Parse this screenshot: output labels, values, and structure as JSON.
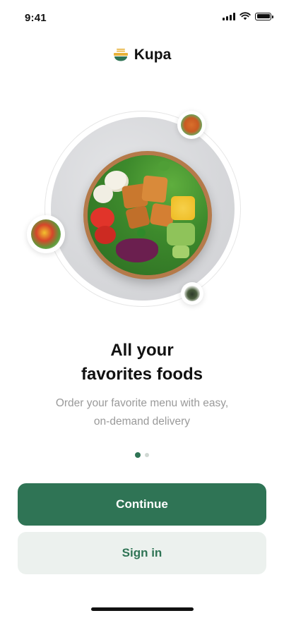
{
  "status_bar": {
    "time": "9:41"
  },
  "brand": {
    "name": "Kupa",
    "icon": "bowl-logo-icon"
  },
  "onboarding": {
    "headline_line1": "All your",
    "headline_line2": "favorites foods",
    "subtitle_line1": "Order your favorite menu with easy,",
    "subtitle_line2": "on-demand delivery",
    "page_index": 0,
    "page_count": 2
  },
  "actions": {
    "continue_label": "Continue",
    "signin_label": "Sign in"
  },
  "colors": {
    "accent": "#2f7455",
    "secondary_bg": "#ecf1ee",
    "muted_text": "#9a9a9a"
  }
}
